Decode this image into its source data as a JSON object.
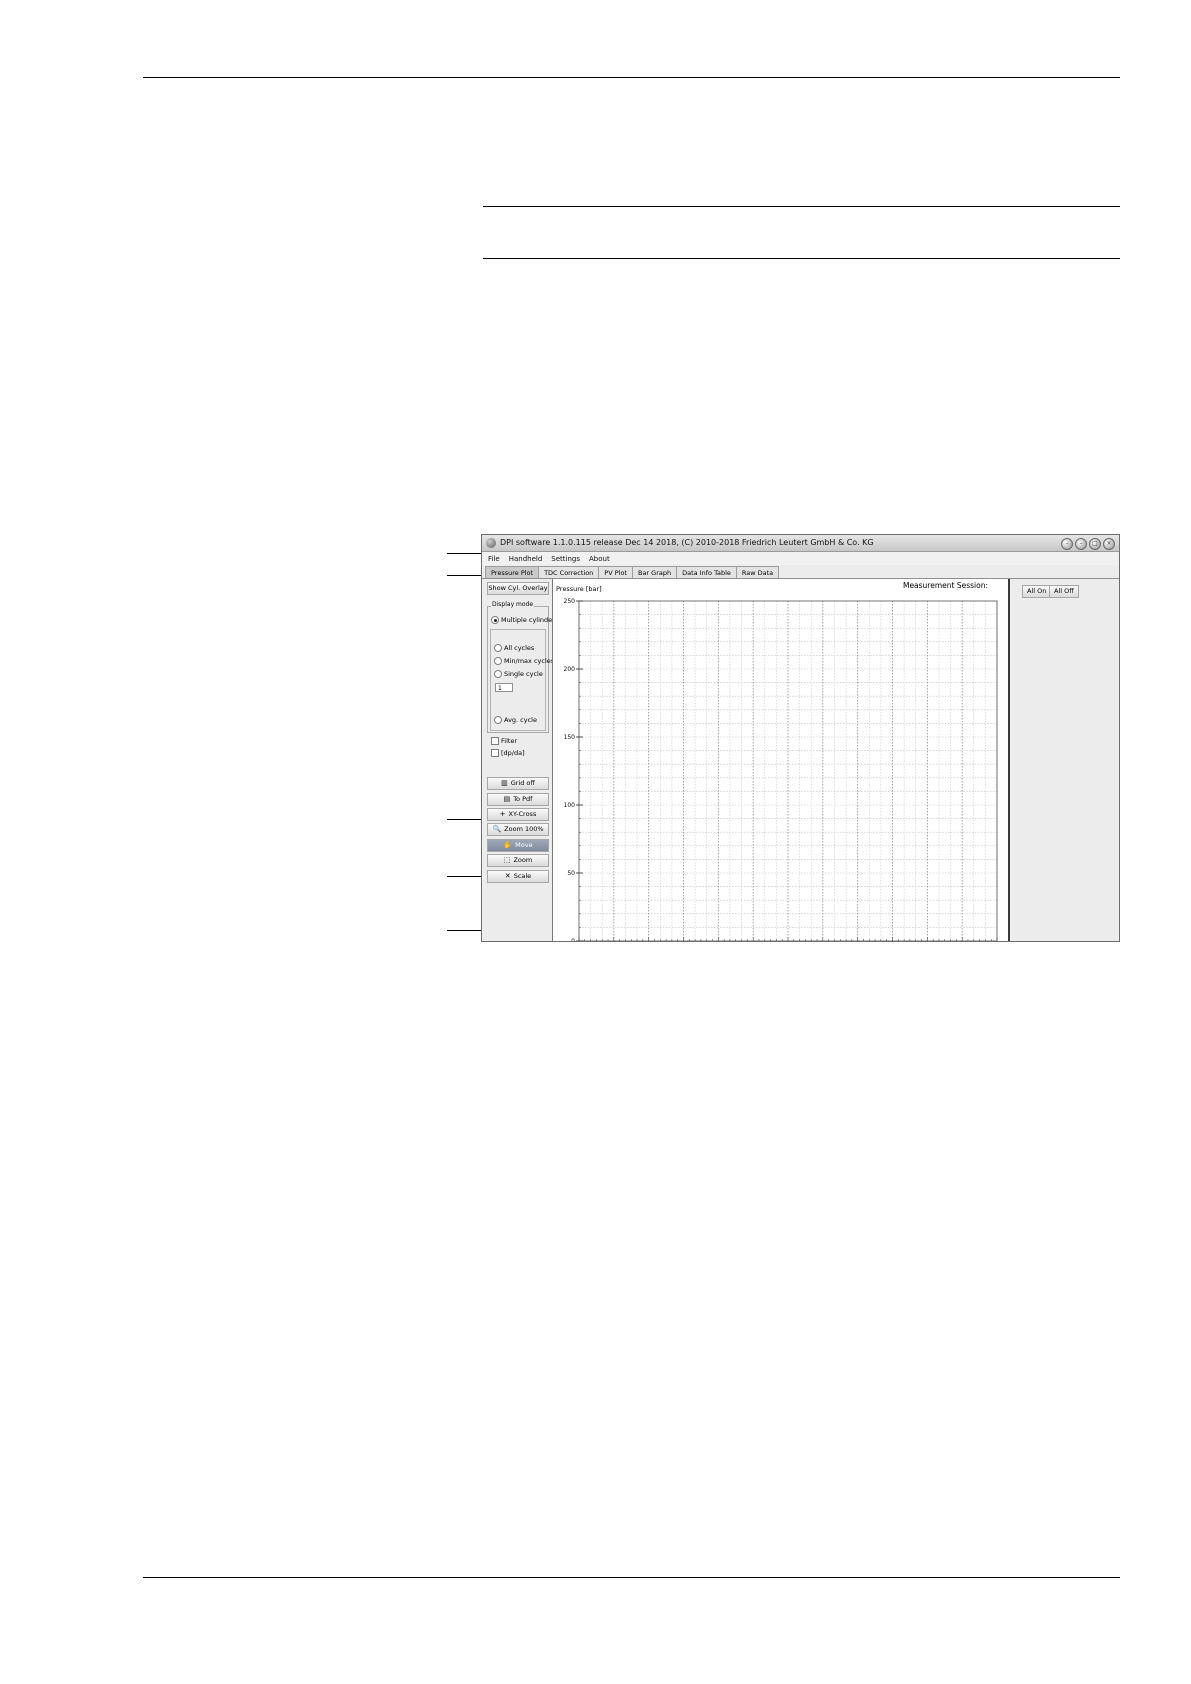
{
  "window": {
    "title": "DPI software 1.1.0.115 release Dec 14 2018, (C) 2010-2018 Friedrich Leutert GmbH & Co. KG",
    "controls": [
      "–",
      "–",
      "□",
      "×"
    ]
  },
  "menu": [
    "File",
    "Handheld",
    "Settings",
    "About"
  ],
  "tabs": [
    "Pressure Plot",
    "TDC Correction",
    "PV Plot",
    "Bar Graph",
    "Data Info Table",
    "Raw Data"
  ],
  "left_panel": {
    "show_overlay": "Show Cyl. Overlay",
    "display_mode_title": "Display mode",
    "multiple_cylinder": "Multiple cylinder",
    "all_cycles": "All cycles",
    "minmax_cycles": "Min/max cycles",
    "single_cycle": "Single cycle",
    "cycle_value": "1",
    "avg_cycle": "Avg. cycle",
    "filter": "Filter",
    "dpda": "[dp/da]",
    "grid_off": "Grid off",
    "to_pdf": "To Pdf",
    "xy_cross": "XY-Cross",
    "zoom100": "Zoom 100%",
    "move": "Move",
    "zoom": "Zoom",
    "scale": "Scale"
  },
  "plot": {
    "ylabel": "Pressure [bar]",
    "session": "Measurement Session:"
  },
  "right_panel": {
    "all_on": "All On",
    "all_off": "All Off"
  },
  "chart_data": {
    "type": "line",
    "ylabel": "Pressure [bar]",
    "yticks": [
      0,
      50,
      100,
      150,
      200,
      250
    ],
    "ylim": [
      0,
      250
    ],
    "grid": true,
    "series": []
  }
}
